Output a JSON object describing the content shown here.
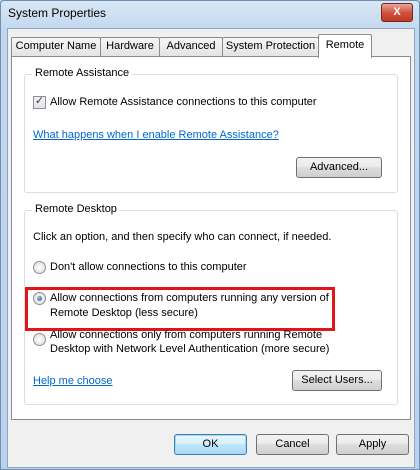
{
  "window": {
    "title": "System Properties",
    "close_label": "X"
  },
  "tabs": [
    {
      "label": "Computer Name"
    },
    {
      "label": "Hardware"
    },
    {
      "label": "Advanced"
    },
    {
      "label": "System Protection"
    },
    {
      "label": "Remote",
      "active": true
    }
  ],
  "remote_assistance": {
    "group_title": "Remote Assistance",
    "allow_checkbox_label": "Allow Remote Assistance connections to this computer",
    "allow_checked": true,
    "help_link": "What happens when I enable Remote Assistance?",
    "advanced_button": "Advanced..."
  },
  "remote_desktop": {
    "group_title": "Remote Desktop",
    "instruction": "Click an option, and then specify who can connect, if needed.",
    "options": [
      {
        "label_line1": "Don't allow connections to this computer",
        "label_line2": "",
        "selected": false
      },
      {
        "label_line1": "Allow connections from computers running any version of",
        "label_line2": "Remote Desktop (less secure)",
        "selected": true
      },
      {
        "label_line1": "Allow connections only from computers running Remote",
        "label_line2": "Desktop with Network Level Authentication (more secure)",
        "selected": false
      }
    ],
    "help_link": "Help me choose",
    "select_users_button": "Select Users..."
  },
  "footer": {
    "ok": "OK",
    "cancel": "Cancel",
    "apply": "Apply"
  },
  "colors": {
    "highlight": "#e0151a",
    "link": "#0066cc"
  }
}
